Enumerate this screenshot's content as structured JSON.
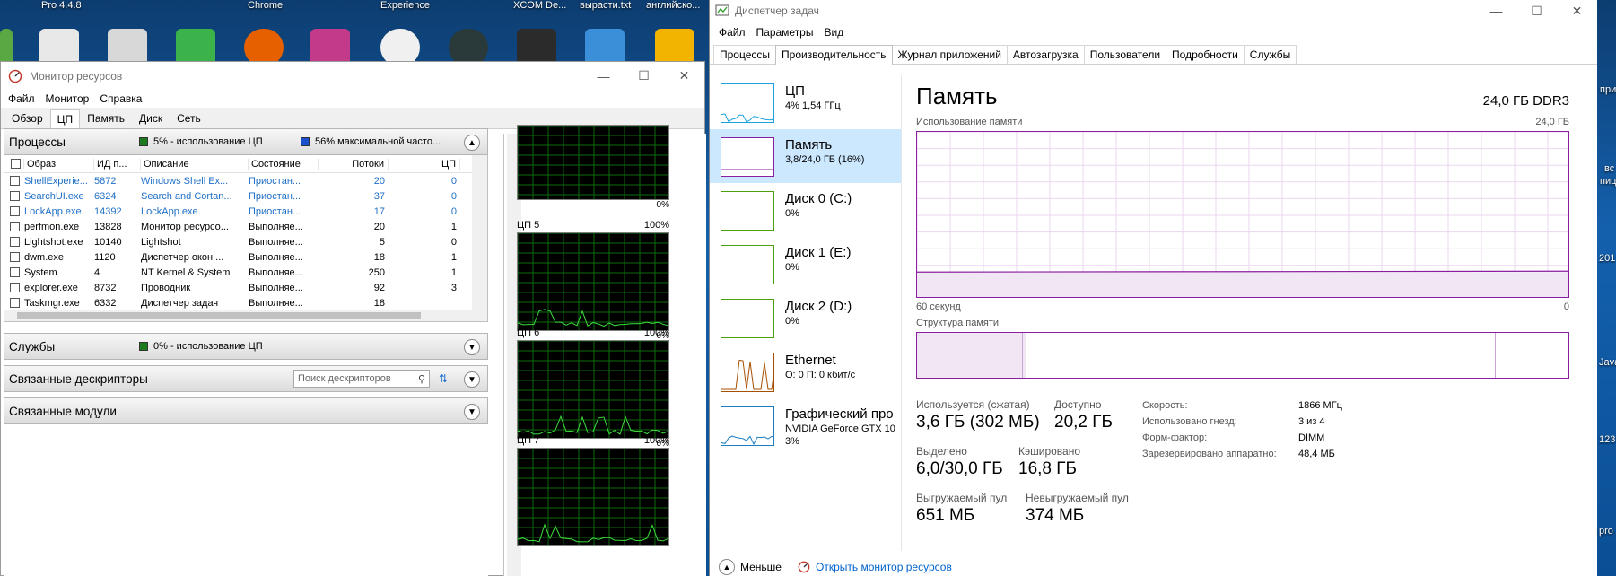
{
  "desktop": {
    "labels": [
      "Pro 4.4.8",
      "Chrome",
      "Experience",
      "XCOM De...",
      "вырасти.txt",
      "английско..."
    ],
    "right_labels": [
      "при",
      "вс",
      "пиц",
      "201",
      "Java",
      "123",
      "pro"
    ]
  },
  "resmon": {
    "title": "Монитор ресурсов",
    "menu": [
      "Файл",
      "Монитор",
      "Справка"
    ],
    "tabs": [
      "Обзор",
      "ЦП",
      "Память",
      "Диск",
      "Сеть"
    ],
    "active_tab": 1,
    "processes": {
      "title": "Процессы",
      "info1": "5% - использование ЦП",
      "info2": "56% максимальной часто...",
      "columns": [
        "Образ",
        "ИД п...",
        "Описание",
        "Состояние",
        "Потоки",
        "ЦП"
      ],
      "rows": [
        {
          "image": "ShellExperie...",
          "pid": "5872",
          "desc": "Windows Shell Ex...",
          "state": "Приостан...",
          "threads": "20",
          "cpu": "0",
          "suspended": true
        },
        {
          "image": "SearchUI.exe",
          "pid": "6324",
          "desc": "Search and Cortan...",
          "state": "Приостан...",
          "threads": "37",
          "cpu": "0",
          "suspended": true
        },
        {
          "image": "LockApp.exe",
          "pid": "14392",
          "desc": "LockApp.exe",
          "state": "Приостан...",
          "threads": "17",
          "cpu": "0",
          "suspended": true
        },
        {
          "image": "perfmon.exe",
          "pid": "13828",
          "desc": "Монитор ресурсо...",
          "state": "Выполняе...",
          "threads": "20",
          "cpu": "1",
          "suspended": false
        },
        {
          "image": "Lightshot.exe",
          "pid": "10140",
          "desc": "Lightshot",
          "state": "Выполняе...",
          "threads": "5",
          "cpu": "0",
          "suspended": false
        },
        {
          "image": "dwm.exe",
          "pid": "1120",
          "desc": "Диспетчер окон ...",
          "state": "Выполняе...",
          "threads": "18",
          "cpu": "1",
          "suspended": false
        },
        {
          "image": "System",
          "pid": "4",
          "desc": "NT Kernel & System",
          "state": "Выполняе...",
          "threads": "250",
          "cpu": "1",
          "suspended": false
        },
        {
          "image": "explorer.exe",
          "pid": "8732",
          "desc": "Проводник",
          "state": "Выполняе...",
          "threads": "92",
          "cpu": "3",
          "suspended": false
        },
        {
          "image": "Taskmgr.exe",
          "pid": "6332",
          "desc": "Диспетчер задач",
          "state": "Выполняе...",
          "threads": "18",
          "cpu": "",
          "suspended": false
        }
      ]
    },
    "services": {
      "title": "Службы",
      "info": "0% - использование ЦП"
    },
    "handles": {
      "title": "Связанные дескрипторы",
      "search_placeholder": "Поиск дескрипторов"
    },
    "modules": {
      "title": "Связанные модули"
    },
    "graphs": [
      {
        "label": "",
        "max": "",
        "min": "0%"
      },
      {
        "label": "ЦП 5",
        "max": "100%",
        "min": "0%"
      },
      {
        "label": "ЦП 6",
        "max": "100%",
        "min": "0%"
      },
      {
        "label": "ЦП 7",
        "max": "100%",
        "min": ""
      }
    ]
  },
  "taskmgr": {
    "title": "Диспетчер задач",
    "menu": [
      "Файл",
      "Параметры",
      "Вид"
    ],
    "tabs": [
      "Процессы",
      "Производительность",
      "Журнал приложений",
      "Автозагрузка",
      "Пользователи",
      "Подробности",
      "Службы"
    ],
    "active_tab": 1,
    "sidebar": [
      {
        "name": "ЦП",
        "sub1": "4% 1,54 ГГц",
        "sub2": "",
        "color": "#1ca1e0",
        "selected": false
      },
      {
        "name": "Память",
        "sub1": "3,8/24,0 ГБ (16%)",
        "sub2": "",
        "color": "#8b1e9f",
        "selected": true
      },
      {
        "name": "Диск 0 (C:)",
        "sub1": "0%",
        "sub2": "",
        "color": "#4ca00d",
        "selected": false
      },
      {
        "name": "Диск 1 (E:)",
        "sub1": "0%",
        "sub2": "",
        "color": "#4ca00d",
        "selected": false
      },
      {
        "name": "Диск 2 (D:)",
        "sub1": "0%",
        "sub2": "",
        "color": "#4ca00d",
        "selected": false
      },
      {
        "name": "Ethernet",
        "sub1": "О: 0 П: 0 кбит/с",
        "sub2": "",
        "color": "#a74f01",
        "selected": false
      },
      {
        "name": "Графический про",
        "sub1": "NVIDIA GeForce GTX 10",
        "sub2": "3%",
        "color": "#1a7dc4",
        "selected": false
      }
    ],
    "memory": {
      "title": "Память",
      "type": "24,0 ГБ DDR3",
      "usage_label": "Использование памяти",
      "usage_max": "24,0 ГБ",
      "time_label": "60 секунд",
      "time_min": "0",
      "structure_label": "Структура памяти",
      "stats": {
        "in_use_label": "Используется (сжатая)",
        "in_use": "3,6 ГБ (302 МБ)",
        "available_label": "Доступно",
        "available": "20,2 ГБ",
        "committed_label": "Выделено",
        "committed": "6,0/30,0 ГБ",
        "cached_label": "Кэшировано",
        "cached": "16,8 ГБ",
        "paged_label": "Выгружаемый пул",
        "paged": "651 МБ",
        "nonpaged_label": "Невыгружаемый пул",
        "nonpaged": "374 МБ"
      },
      "details": [
        {
          "k": "Скорость:",
          "v": "1866 МГц"
        },
        {
          "k": "Использовано гнезд:",
          "v": "3 из 4"
        },
        {
          "k": "Форм-фактор:",
          "v": "DIMM"
        },
        {
          "k": "Зарезервировано аппаратно:",
          "v": "48,4 МБ"
        }
      ],
      "usage_fraction": 0.16
    },
    "footer": {
      "less": "Меньше",
      "open_resmon": "Открыть монитор ресурсов"
    }
  }
}
